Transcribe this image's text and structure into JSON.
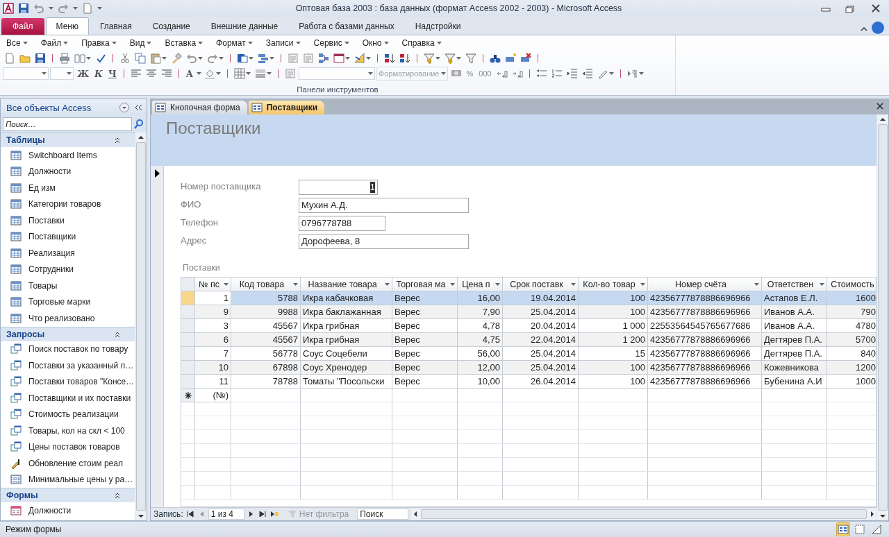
{
  "window": {
    "title": "Оптовая база 2003 : база данных (формат Access 2002 - 2003)  -  Microsoft Access"
  },
  "ribbon_tabs": [
    {
      "label": "Файл",
      "kind": "file",
      "selected": false
    },
    {
      "label": "Меню",
      "kind": "tab",
      "selected": true
    },
    {
      "label": "Главная",
      "kind": "tab",
      "selected": false
    },
    {
      "label": "Создание",
      "kind": "tab",
      "selected": false
    },
    {
      "label": "Внешние данные",
      "kind": "tab",
      "selected": false
    },
    {
      "label": "Работа с базами данных",
      "kind": "tab",
      "selected": false
    },
    {
      "label": "Надстройки",
      "kind": "tab",
      "selected": false
    }
  ],
  "menu": [
    "Все",
    "Файл",
    "Правка",
    "Вид",
    "Вставка",
    "Формат",
    "Записи",
    "Сервис",
    "Окно",
    "Справка"
  ],
  "format_buttons": [
    "Ж",
    "К",
    "Ч",
    "A",
    "Форматирование",
    "%",
    "000"
  ],
  "group_label": "Панели инструментов",
  "nav": {
    "title": "Все объекты Access",
    "search_placeholder": "Поиск…",
    "groups": [
      {
        "title": "Таблицы",
        "items": [
          {
            "label": "Switchboard Items",
            "kind": "table"
          },
          {
            "label": "Должности",
            "kind": "table"
          },
          {
            "label": "Ед изм",
            "kind": "table"
          },
          {
            "label": "Категории товаров",
            "kind": "table"
          },
          {
            "label": "Поставки",
            "kind": "table"
          },
          {
            "label": "Поставщики",
            "kind": "table"
          },
          {
            "label": "Реализация",
            "kind": "table"
          },
          {
            "label": "Сотрудники",
            "kind": "table"
          },
          {
            "label": "Товары",
            "kind": "table"
          },
          {
            "label": "Торговые марки",
            "kind": "table"
          },
          {
            "label": "Что реализовано",
            "kind": "table"
          }
        ]
      },
      {
        "title": "Запросы",
        "items": [
          {
            "label": "Поиск поставок по товару",
            "kind": "query"
          },
          {
            "label": "Поставки за указанный п…",
            "kind": "query"
          },
          {
            "label": "Поставки товаров \"Консе…",
            "kind": "query"
          },
          {
            "label": "Поставщики и их поставки",
            "kind": "query"
          },
          {
            "label": "Стоимость реализации",
            "kind": "query"
          },
          {
            "label": "Товары, кол на скл < 100",
            "kind": "query"
          },
          {
            "label": "Цены поставок товаров",
            "kind": "query"
          },
          {
            "label": "Обновление стоим реал",
            "kind": "update"
          },
          {
            "label": "Минимальные цены у ра…",
            "kind": "crosstab"
          }
        ]
      },
      {
        "title": "Формы",
        "items": [
          {
            "label": "Должности",
            "kind": "form"
          }
        ]
      }
    ]
  },
  "document_tabs": [
    {
      "label": "Кнопочная форма",
      "selected": false
    },
    {
      "label": "Поставщики",
      "selected": true
    }
  ],
  "form": {
    "title": "Поставщики",
    "fields": [
      {
        "label": "Номер поставщика",
        "value": "1",
        "kind": "number",
        "selected": true
      },
      {
        "label": "ФИО",
        "value": "Мухин А.Д.",
        "kind": "text",
        "selected": false
      },
      {
        "label": "Телефон",
        "value": "0796778788",
        "kind": "short",
        "selected": false
      },
      {
        "label": "Адрес",
        "value": "Дорофеева, 8",
        "kind": "text",
        "selected": false
      }
    ],
    "subform": {
      "label": "Поставки",
      "columns": [
        {
          "label": "№ пс",
          "kind": "number"
        },
        {
          "label": "Код товара",
          "kind": "number"
        },
        {
          "label": "Название товара",
          "kind": "text"
        },
        {
          "label": "Торговая ма",
          "kind": "text"
        },
        {
          "label": "Цена п",
          "kind": "number"
        },
        {
          "label": "Срок поставк",
          "kind": "number"
        },
        {
          "label": "Кол-во товар",
          "kind": "number"
        },
        {
          "label": "Номер счёта",
          "kind": "text"
        },
        {
          "label": "Ответствен",
          "kind": "text"
        },
        {
          "label": "Стоимость",
          "kind": "number"
        }
      ],
      "rows": [
        {
          "selected": true,
          "cells": [
            "1",
            "5788",
            "Икра кабачковая",
            "Верес",
            "16,00",
            "19.04.2014",
            "100",
            "42356777878886696966",
            "Астапов Е.Л.",
            "1600"
          ]
        },
        {
          "selected": false,
          "cells": [
            "9",
            "9988",
            "Икра баклажанная",
            "Верес",
            "7,90",
            "25.04.2014",
            "100",
            "42356777878886696966",
            "Иванов А.А.",
            "790"
          ]
        },
        {
          "selected": false,
          "cells": [
            "3",
            "45567",
            "Икра грибная",
            "Верес",
            "4,78",
            "20.04.2014",
            "1 000",
            "22553564545765677686",
            "Иванов А.А.",
            "4780"
          ]
        },
        {
          "selected": false,
          "cells": [
            "6",
            "45567",
            "Икра грибная",
            "Верес",
            "4,75",
            "22.04.2014",
            "1 200",
            "42356777878886696966",
            "Дегтярев П.А.",
            "5700"
          ]
        },
        {
          "selected": false,
          "cells": [
            "7",
            "56778",
            "Соус Соцебели",
            "Верес",
            "56,00",
            "25.04.2014",
            "15",
            "42356777878886696966",
            "Дегтярев П.А.",
            "840"
          ]
        },
        {
          "selected": false,
          "cells": [
            "10",
            "67898",
            "Соус Хренодер",
            "Верес",
            "12,00",
            "25.04.2014",
            "100",
            "42356777878886696966",
            "Кожевникова",
            "1200"
          ]
        },
        {
          "selected": false,
          "cells": [
            "11",
            "78788",
            "Томаты \"Посольски",
            "Верес",
            "10,00",
            "26.04.2014",
            "100",
            "42356777878886696966",
            "Бубенина А.И",
            "1000"
          ]
        }
      ],
      "new_row": "(№)"
    }
  },
  "record_nav": {
    "label": "Запись:",
    "position": "1 из 4",
    "filter": "Нет фильтра",
    "search": "Поиск"
  },
  "status_bar": {
    "text": "Режим формы",
    "views": [
      {
        "selected": true
      },
      {
        "selected": false
      },
      {
        "selected": false
      }
    ]
  }
}
